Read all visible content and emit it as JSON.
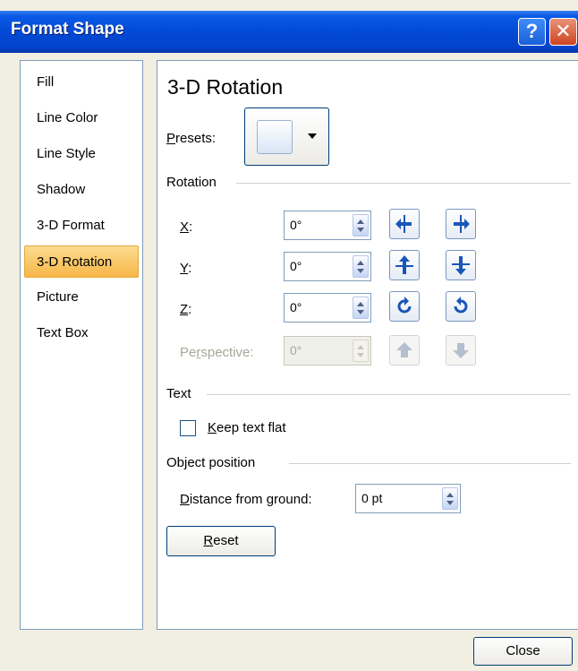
{
  "window": {
    "title": "Format Shape",
    "help_glyph": "?",
    "close_glyph": "✕"
  },
  "categories": [
    {
      "label": "Fill"
    },
    {
      "label": "Line Color"
    },
    {
      "label": "Line Style"
    },
    {
      "label": "Shadow"
    },
    {
      "label": "3-D Format"
    },
    {
      "label": "3-D Rotation",
      "selected": true
    },
    {
      "label": "Picture"
    },
    {
      "label": "Text Box"
    }
  ],
  "panel": {
    "heading": "3-D Rotation",
    "presets": {
      "prefix": "",
      "key": "P",
      "suffix": "resets:"
    },
    "rotation": {
      "section": "Rotation",
      "x": {
        "key": "X",
        "suffix": ":",
        "value": "0°"
      },
      "y": {
        "key": "Y",
        "suffix": ":",
        "value": "0°"
      },
      "z": {
        "key": "Z",
        "suffix": ":",
        "value": "0°"
      },
      "perspective": {
        "prefix": "Pe",
        "key": "r",
        "suffix": "spective:",
        "value": "0°",
        "disabled": true
      }
    },
    "text": {
      "section": "Text",
      "keep_flat": {
        "key": "K",
        "suffix": "eep text flat",
        "checked": false
      }
    },
    "object_position": {
      "section": "Object position",
      "distance": {
        "key": "D",
        "suffix": "istance from ground:",
        "value": "0 pt"
      }
    },
    "reset": {
      "key": "R",
      "suffix": "eset"
    }
  },
  "footer": {
    "close_label": "Close"
  },
  "colors": {
    "titlebar": "#0148d4",
    "selected_category": "#f7b648",
    "rotate_icon": "#1a56b8"
  }
}
